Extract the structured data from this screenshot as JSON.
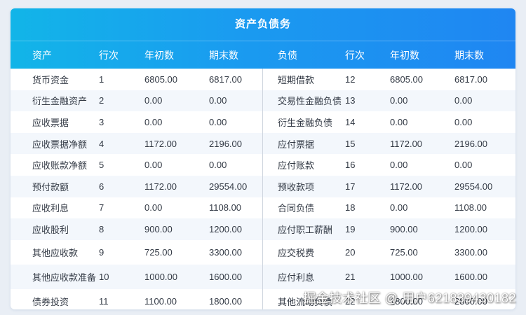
{
  "table": {
    "title": "资产负债务",
    "headers": {
      "asset": "资产",
      "asset_row": "行次",
      "asset_begin": "年初数",
      "asset_end": "期末数",
      "liability": "负债",
      "liability_row": "行次",
      "liability_begin": "年初数",
      "liability_end": "期末数"
    },
    "rows": [
      {
        "asset": "货币资金",
        "a_row": "1",
        "a_begin": "6805.00",
        "a_end": "6817.00",
        "liability": "短期借款",
        "l_row": "12",
        "l_begin": "6805.00",
        "l_end": "6817.00"
      },
      {
        "asset": "衍生金融资产",
        "a_row": "2",
        "a_begin": "0.00",
        "a_end": "0.00",
        "liability": "交易性金融负债",
        "l_row": "13",
        "l_begin": "0.00",
        "l_end": "0.00"
      },
      {
        "asset": "应收票据",
        "a_row": "3",
        "a_begin": "0.00",
        "a_end": "0.00",
        "liability": "衍生金融负债",
        "l_row": "14",
        "l_begin": "0.00",
        "l_end": "0.00"
      },
      {
        "asset": "应收票据净额",
        "a_row": "4",
        "a_begin": "1172.00",
        "a_end": "2196.00",
        "liability": "应付票据",
        "l_row": "15",
        "l_begin": "1172.00",
        "l_end": "2196.00"
      },
      {
        "asset": "应收账款净额",
        "a_row": "5",
        "a_begin": "0.00",
        "a_end": "0.00",
        "liability": "应付账款",
        "l_row": "16",
        "l_begin": "0.00",
        "l_end": "0.00"
      },
      {
        "asset": "预付款额",
        "a_row": "6",
        "a_begin": "1172.00",
        "a_end": "29554.00",
        "liability": "预收款项",
        "l_row": "17",
        "l_begin": "1172.00",
        "l_end": "29554.00"
      },
      {
        "asset": "应收利息",
        "a_row": "7",
        "a_begin": "0.00",
        "a_end": "1108.00",
        "liability": "合同负债",
        "l_row": "18",
        "l_begin": "0.00",
        "l_end": "1108.00"
      },
      {
        "asset": "应收股利",
        "a_row": "8",
        "a_begin": "900.00",
        "a_end": "1200.00",
        "liability": "应付职工薪酬",
        "l_row": "19",
        "l_begin": "900.00",
        "l_end": "1200.00"
      },
      {
        "asset": "其他应收款",
        "a_row": "9",
        "a_begin": "725.00",
        "a_end": "3300.00",
        "liability": "应交税费",
        "l_row": "20",
        "l_begin": "725.00",
        "l_end": "3300.00"
      },
      {
        "asset": "其他应收款准备",
        "a_row": "10",
        "a_begin": "1000.00",
        "a_end": "1600.00",
        "liability": "应付利息",
        "l_row": "21",
        "l_begin": "1000.00",
        "l_end": "1600.00"
      },
      {
        "asset": "债券投资",
        "a_row": "11",
        "a_begin": "1100.00",
        "a_end": "1800.00",
        "liability": "其他流动负债",
        "l_row": "22",
        "l_begin": "1800.00",
        "l_end": "2800.00"
      }
    ]
  },
  "watermark": "掘金技术社区 @ 用户621839430182",
  "colors": {
    "header_start": "#12b5e8",
    "header_end": "#1f86f2",
    "stripe": "#f3f7fc"
  }
}
